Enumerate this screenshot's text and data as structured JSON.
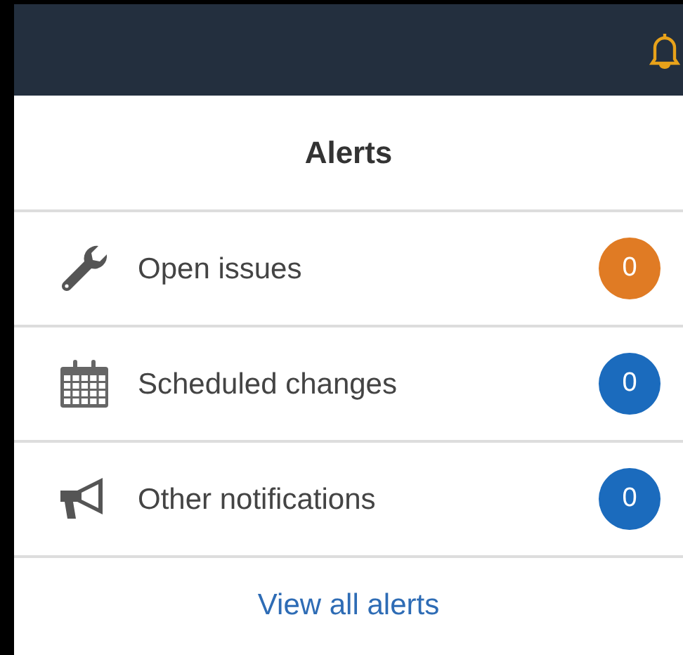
{
  "panel": {
    "title": "Alerts",
    "items": [
      {
        "kind": "wrench",
        "label": "Open issues",
        "count": "0",
        "color": "#e07b24"
      },
      {
        "kind": "calendar",
        "label": "Scheduled changes",
        "count": "0",
        "color": "#1b6bbd"
      },
      {
        "kind": "megaphone",
        "label": "Other notifications",
        "count": "0",
        "color": "#1b6bbd"
      }
    ],
    "footer_link": "View all alerts"
  }
}
